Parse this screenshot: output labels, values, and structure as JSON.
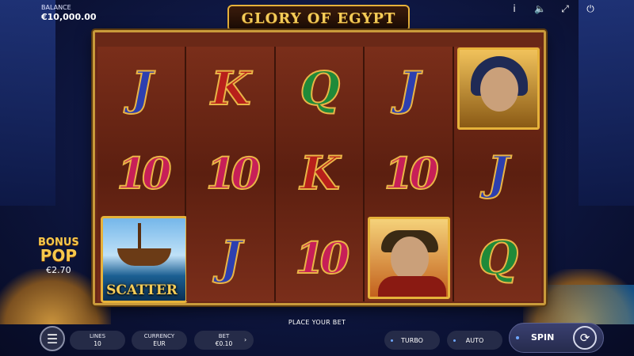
{
  "balance": {
    "label": "BALANCE",
    "value": "€10,000.00"
  },
  "top_icons": [
    "info-icon",
    "sound-icon",
    "fullscreen-icon",
    "power-icon"
  ],
  "logo": {
    "text": "GLORY OF EGYPT"
  },
  "reels": [
    [
      "J",
      "10",
      "SCATTER"
    ],
    [
      "K",
      "10",
      "J"
    ],
    [
      "Q",
      "K",
      "10"
    ],
    [
      "J",
      "10",
      "CAESAR"
    ],
    [
      "CLEOPATRA",
      "J",
      "Q"
    ]
  ],
  "scatter_label": "SCATTER",
  "bonus_pop": {
    "line1": "BONUS",
    "line2": "POP",
    "value": "€2.70"
  },
  "status_text": "PLACE YOUR BET",
  "controls": {
    "lines": {
      "label": "LINES",
      "value": "10"
    },
    "currency": {
      "label": "CURRENCY",
      "value": "EUR"
    },
    "bet": {
      "label": "BET",
      "value": "€0.10"
    },
    "turbo": "TURBO",
    "auto": "AUTO",
    "spin": "SPIN"
  },
  "colors": {
    "gold": "#e6b23a",
    "reel_bg": "#6a2817",
    "accent_blue": "#6fa7ff"
  }
}
